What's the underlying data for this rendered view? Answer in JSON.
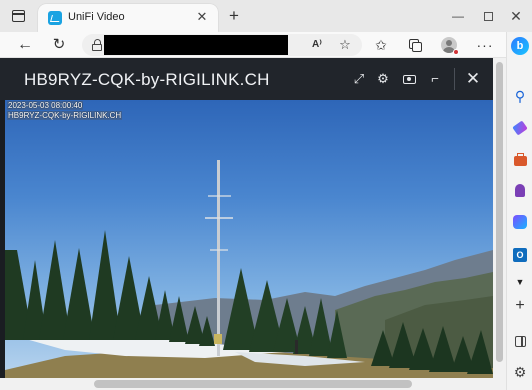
{
  "browser": {
    "tab": {
      "title": "UniFi Video",
      "close_glyph": "✕"
    },
    "new_tab_glyph": "+",
    "window_controls": {
      "minimize": "—",
      "close": "✕"
    },
    "nav": {
      "back": "←",
      "reload": "↻"
    },
    "address": {
      "read_aloud": "A⁾",
      "favorite_add": "☆"
    },
    "toolbar": {
      "favorites": "✩",
      "more": "···"
    },
    "sidebar": {
      "bing": "b",
      "search": "⚲",
      "outlook": "O",
      "drop": "▼",
      "add": "+",
      "settings": "⚙"
    }
  },
  "viewer": {
    "title": "HB9RYZ-CQK-by-RIGILINK.CH",
    "icons": {
      "expand": "⤢",
      "settings": "⚙",
      "cctv": "⌐",
      "close": "✕"
    },
    "osd": {
      "timestamp": "2023-05-03 08:00:40",
      "camera_name": "HB9RYZ-CQK-by-RIGILINK.CH"
    }
  },
  "colors": {
    "header_bg": "#21252b",
    "accent": "#1ba3e2",
    "sky_top": "#2e66b8",
    "sky_bottom": "#b8d4ee"
  }
}
